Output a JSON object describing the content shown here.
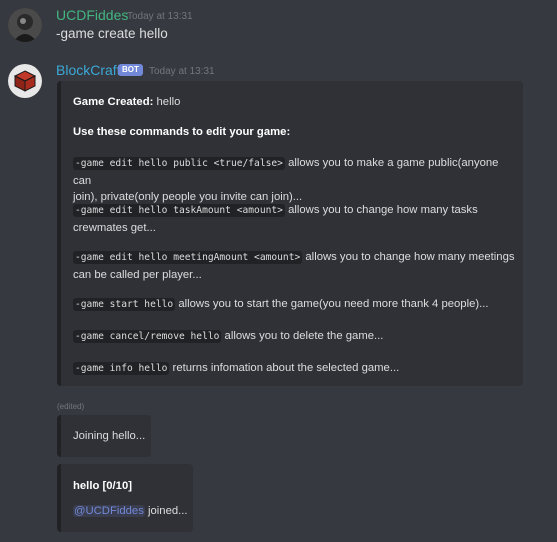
{
  "messages": [
    {
      "author": "UCDFiddes",
      "author_color": "#43b581",
      "timestamp": "Today at 13:31",
      "text": "-game create hello"
    },
    {
      "author": "BlockCraft",
      "author_color": "#3ba9d8",
      "bot_tag": "BOT",
      "timestamp": "Today at 13:31",
      "embed": {
        "created_label": "Game Created:",
        "created_value": "hello",
        "heading": "Use these commands to edit your game:",
        "commands": [
          {
            "code": "-game edit hello public <true/false>",
            "desc_line1": " allows you to make a game public(anyone can",
            "desc_line2": "join), private(only people you invite can join)..."
          },
          {
            "code": "-game edit hello taskAmount <amount>",
            "desc_line1": " allows you to change how many tasks",
            "desc_line2": "crewmates get..."
          },
          {
            "code": "-game edit hello meetingAmount <amount>",
            "desc_line1": " allows you to change how many meetings",
            "desc_line2": "can be called per player..."
          },
          {
            "code": "-game start hello",
            "desc_line1": " allows you to start the game(you need more thank 4 people)..."
          },
          {
            "code": "-game cancel/remove hello",
            "desc_line1": " allows you to delete the game..."
          },
          {
            "code": "-game info hello",
            "desc_line1": " returns infomation about the selected game..."
          }
        ]
      },
      "edited_label": "(edited)",
      "embed2": {
        "text": "Joining hello..."
      },
      "embed3": {
        "title": "hello [0/10]",
        "mention": "@UCDFiddes",
        "joined_text": " joined..."
      }
    }
  ]
}
